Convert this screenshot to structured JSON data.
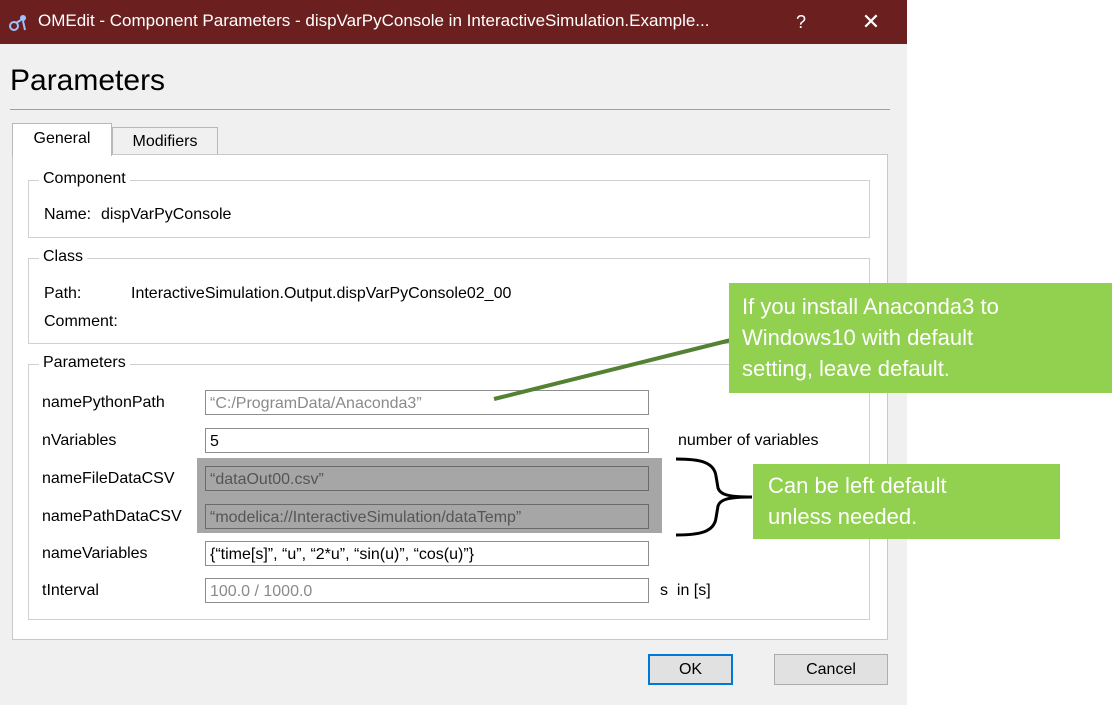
{
  "window": {
    "title": "OMEdit - Component Parameters - dispVarPyConsole in InteractiveSimulation.Example...",
    "help": "?",
    "close": "✕"
  },
  "heading": "Parameters",
  "tabs": [
    {
      "label": "General",
      "active": true
    },
    {
      "label": "Modifiers",
      "active": false
    }
  ],
  "component": {
    "group": "Component",
    "name_label": "Name:",
    "name_value": "dispVarPyConsole"
  },
  "class_info": {
    "group": "Class",
    "path_label": "Path:",
    "path_value": "InteractiveSimulation.Output.dispVarPyConsole02_00",
    "comment_label": "Comment:"
  },
  "parameters": {
    "group": "Parameters",
    "rows": [
      {
        "label": "namePythonPath",
        "value": "“C:/ProgramData/Anaconda3”",
        "placeholder": true
      },
      {
        "label": "nVariables",
        "value": "5",
        "placeholder": false,
        "unit": "number of variables"
      },
      {
        "label": "nameFileDataCSV",
        "value": "“dataOut00.csv”",
        "placeholder": true
      },
      {
        "label": "namePathDataCSV",
        "value": "“modelica://InteractiveSimulation/dataTemp”",
        "placeholder": true
      },
      {
        "label": "nameVariables",
        "value": "{“time[s]”, “u”, “2*u”, “sin(u)”, “cos(u)”}",
        "placeholder": false
      },
      {
        "label": "tInterval",
        "value": "100.0 / 1000.0",
        "placeholder": true,
        "unit": "s  in [s]"
      }
    ]
  },
  "buttons": {
    "ok": "OK",
    "cancel": "Cancel"
  },
  "annotations": {
    "callout1": {
      "lines": [
        "If you install Anaconda3 to",
        "Windows10 with default",
        "setting, leave default."
      ]
    },
    "callout2": {
      "lines": [
        "Can be left default",
        "unless needed."
      ]
    }
  },
  "colors": {
    "titlebar": "#6b1f1f",
    "callout": "#92d050",
    "connector": "#548235",
    "highlight": "#a6a6a6",
    "ok_border": "#0078d7"
  }
}
